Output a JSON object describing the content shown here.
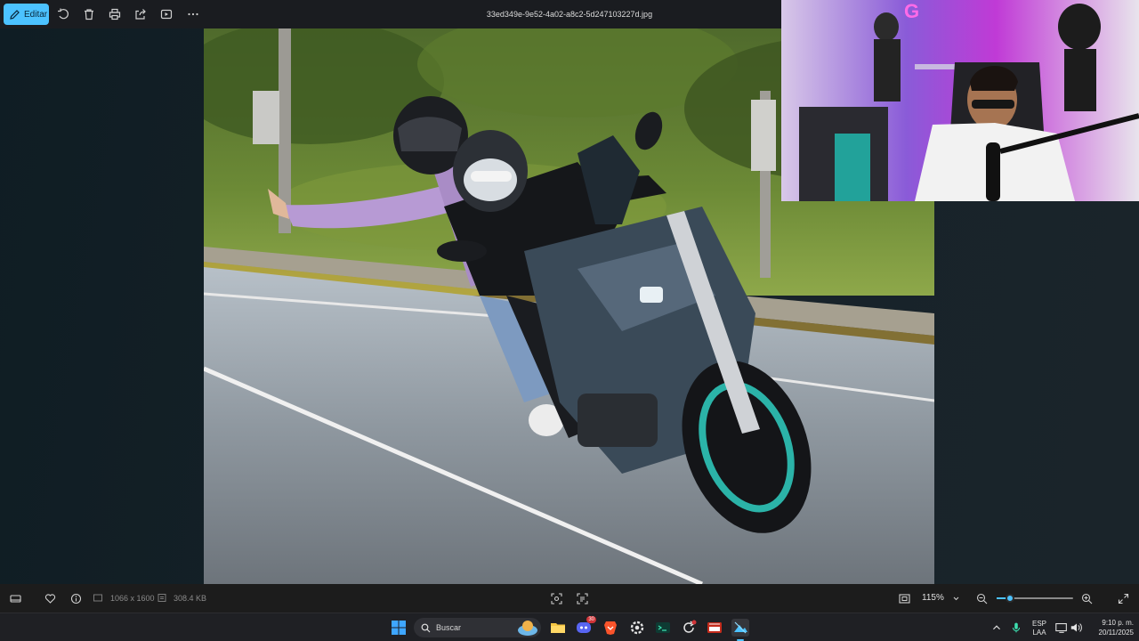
{
  "toolbar": {
    "edit_label": "Editar",
    "filename": "33ed349e-9e52-4a02-a8c2-5d247103227d.jpg",
    "icons": [
      "edit-icon",
      "rotate-icon",
      "delete-icon",
      "print-icon",
      "share-icon",
      "slideshow-icon",
      "more-icon"
    ]
  },
  "statusbar": {
    "dimensions": "1066 x 1600",
    "file_size": "308.4 KB",
    "zoom_level": "115%",
    "zoom_fraction": 0.18
  },
  "taskbar": {
    "search_placeholder": "Buscar",
    "language_top": "ESP",
    "language_bottom": "LAA",
    "time": "9:10 p. m.",
    "date": "20/11/2025",
    "notification_badge": "30"
  },
  "colors": {
    "accent": "#4cc2ff",
    "wheel_accent": "#2bb3a8",
    "sweater": "#b79ad4"
  }
}
